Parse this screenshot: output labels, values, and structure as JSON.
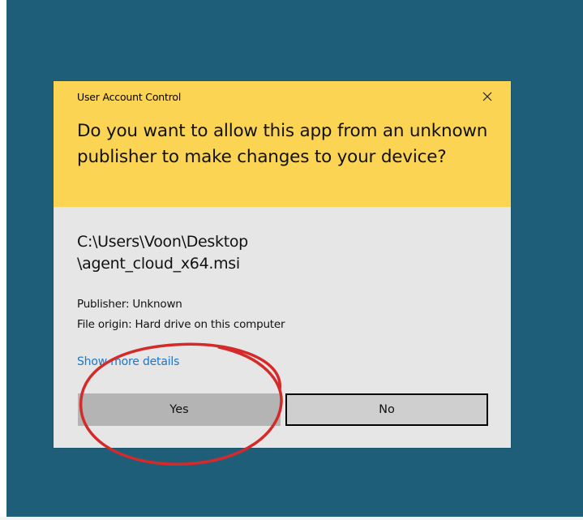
{
  "dialog": {
    "window_title": "User Account Control",
    "question": "Do you want to allow this app from an unknown publisher to make changes to your device?",
    "file_path_line1": "C:\\Users\\Voon\\Desktop",
    "file_path_line2": "\\agent_cloud_x64.msi",
    "publisher": "Publisher: Unknown",
    "file_origin": "File origin: Hard drive on this computer",
    "details_link": "Show more details",
    "yes_label": "Yes",
    "no_label": "No"
  },
  "colors": {
    "desktop_background": "#1f5e78",
    "header_background": "#fbd453",
    "dialog_background": "#e6e6e6",
    "link": "#1a77c9",
    "annotation_circle": "#d42a2a"
  },
  "icons": {
    "close": "close-icon"
  }
}
